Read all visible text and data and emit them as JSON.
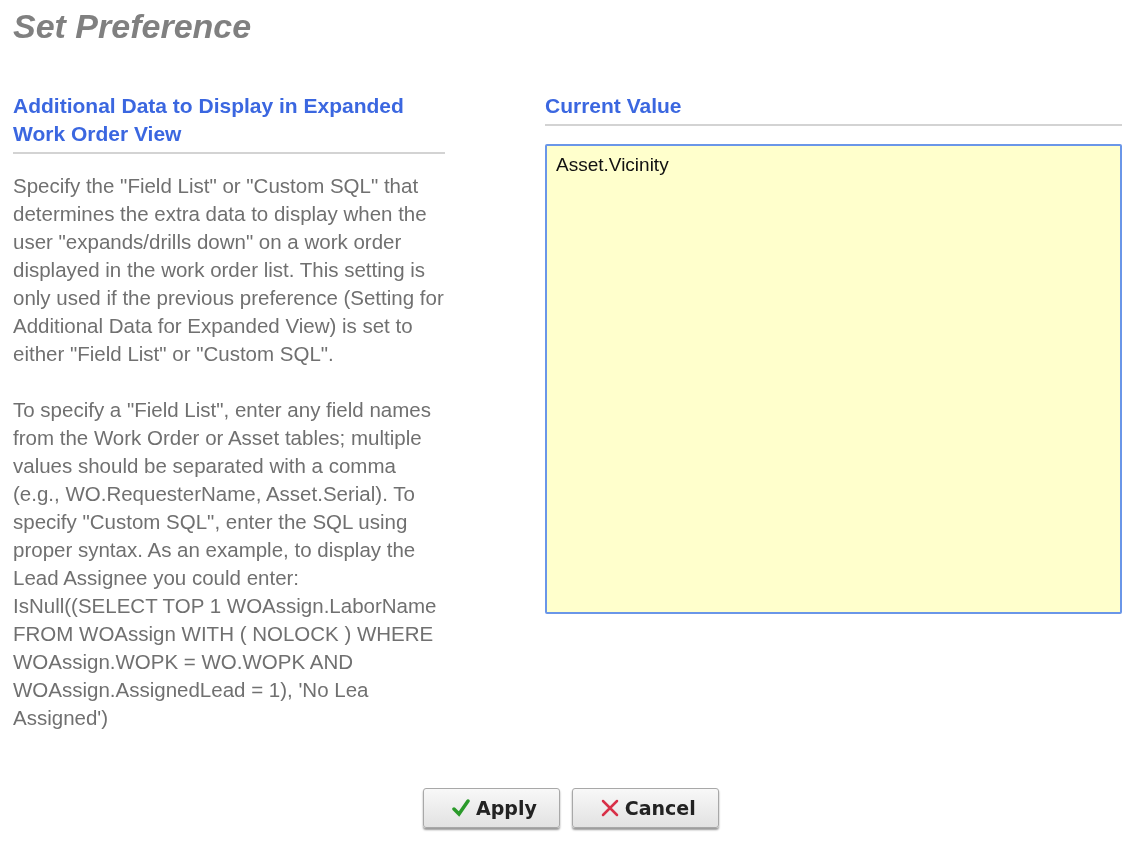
{
  "page_title": "Set Preference",
  "preference": {
    "heading": "Additional Data to Display in Expanded Work Order View",
    "description": [
      "Specify the \"Field List\" or \"Custom SQL\" that determines the extra data to display when the user \"expands/drills down\" on a work order displayed in the work order list. This setting is only used if the previous preference (Setting for Additional Data for Expanded View) is set to either \"Field List\" or \"Custom SQL\".",
      "To specify a \"Field List\", enter any field names from the Work Order or Asset tables; multiple values should be separated with a comma (e.g., WO.RequesterName, Asset.Serial). To specify \"Custom SQL\", enter the SQL using proper syntax. As an example, to display the Lead Assignee you could enter: IsNull((SELECT TOP 1 WOAssign.LaborName FROM WOAssign WITH ( NOLOCK ) WHERE WOAssign.WOPK = WO.WOPK AND WOAssign.AssignedLead = 1), 'No Lea Assigned')"
    ]
  },
  "current_value": {
    "heading": "Current Value",
    "value": "Asset.Vicinity"
  },
  "buttons": [
    {
      "kind": "apply",
      "label": "Apply"
    },
    {
      "kind": "cancel",
      "label": "Cancel"
    }
  ]
}
